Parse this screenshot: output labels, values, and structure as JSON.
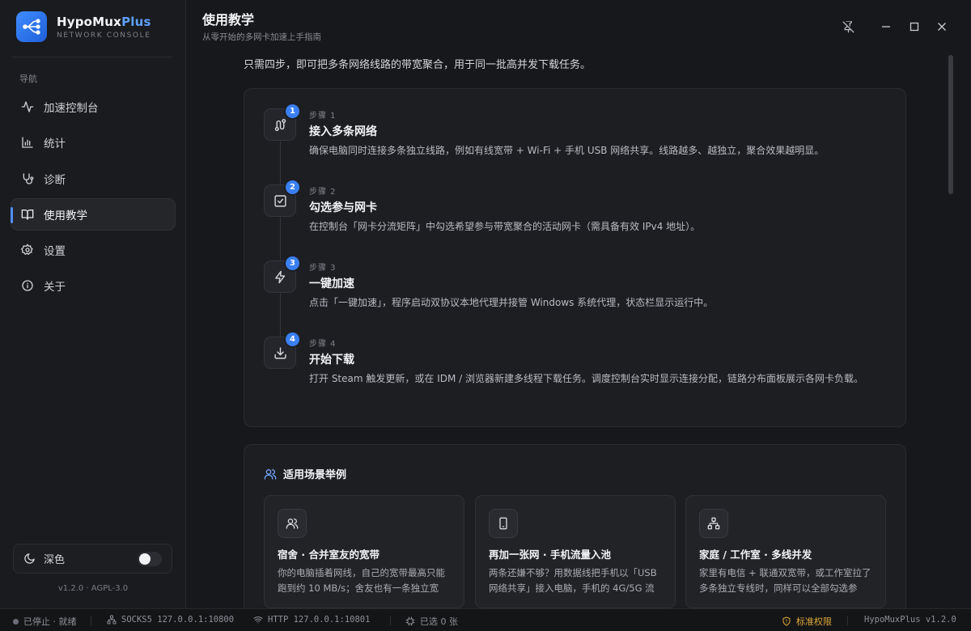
{
  "app": {
    "name_main": "HypoMux",
    "name_accent": "Plus",
    "subtitle": "NETWORK CONSOLE",
    "version_footer": "v1.2.0 · AGPL-3.0"
  },
  "sidebar": {
    "heading": "导航",
    "items": [
      {
        "label": "加速控制台",
        "icon": "activity-icon"
      },
      {
        "label": "统计",
        "icon": "bar-chart-icon"
      },
      {
        "label": "诊断",
        "icon": "stethoscope-icon"
      },
      {
        "label": "使用教学",
        "icon": "book-open-icon",
        "active": true
      },
      {
        "label": "设置",
        "icon": "gear-icon"
      },
      {
        "label": "关于",
        "icon": "info-icon"
      }
    ],
    "theme_label": "深色"
  },
  "header": {
    "title": "使用教学",
    "subtitle": "从零开始的多网卡加速上手指南"
  },
  "intro": "只需四步，即可把多条网络线路的带宽聚合，用于同一批高并发下载任务。",
  "steps": [
    {
      "badge": "1",
      "kicker": "步骤 1",
      "title": "接入多条网络",
      "desc": "确保电脑同时连接多条独立线路，例如有线宽带 + Wi-Fi + 手机 USB 网络共享。线路越多、越独立，聚合效果越明显。"
    },
    {
      "badge": "2",
      "kicker": "步骤 2",
      "title": "勾选参与网卡",
      "desc": "在控制台「网卡分流矩阵」中勾选希望参与带宽聚合的活动网卡（需具备有效 IPv4 地址）。"
    },
    {
      "badge": "3",
      "kicker": "步骤 3",
      "title": "一键加速",
      "desc": "点击「一键加速」，程序启动双协议本地代理并接管 Windows 系统代理，状态栏显示运行中。"
    },
    {
      "badge": "4",
      "kicker": "步骤 4",
      "title": "开始下载",
      "desc": "打开 Steam 触发更新，或在 IDM / 浏览器新建多线程下载任务。调度控制台实时显示连接分配，链路分布面板展示各网卡负载。"
    }
  ],
  "scenarios": {
    "title": "适用场景举例",
    "items": [
      {
        "title": "宿舍 · 合并室友的宽带",
        "desc": "你的电脑插着网线，自己的宽带最高只能跑到约 10 MB/s；舍友也有一条独立宽"
      },
      {
        "title": "再加一张网 · 手机流量入池",
        "desc": "两条还嫌不够？用数据线把手机以「USB 网络共享」接入电脑，手机的 4G/5G 流"
      },
      {
        "title": "家庭 / 工作室 · 多线并发",
        "desc": "家里有电信 + 联通双宽带，或工作室拉了多条独立专线时，同样可以全部勾选参"
      }
    ]
  },
  "statusbar": {
    "state": "已停止 · 就绪",
    "socks": "SOCKS5 127.0.0.1:10800",
    "http": "HTTP 127.0.0.1:10801",
    "selected": "已选 0 张",
    "permission": "标准权限",
    "version": "HypoMuxPlus v1.2.0"
  },
  "colors": {
    "accent": "#3a7ff2",
    "background": "#17181b",
    "warning": "#e0a93a"
  }
}
